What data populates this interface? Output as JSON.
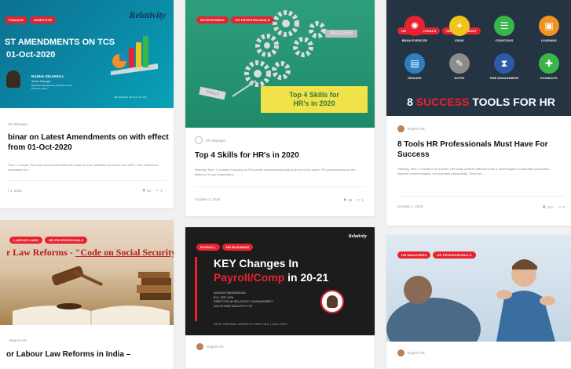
{
  "cards": {
    "c1": {
      "tags": [
        "FINANCE",
        "DIRECTIVE"
      ],
      "brand": "Relativity",
      "banner_line1": "ST AMENDMENTS ON TCS",
      "banner_line2": "01-Oct-2020",
      "presenter_name": "RADHA SELVARAJ",
      "presenter_role": "Senior Manager",
      "presenter_org": "Relativity Management Solutions India Private Limited",
      "footer_text": "BUSINESS MUST GO ON",
      "author": "HR Manager",
      "title": "binar on Latest Amendments on with effect from 01-Oct-2020",
      "excerpt": "Time: 1 minute There are several amendments made on Tax Collection at Source, Act 2020. This article is to summarize all ...",
      "date": "r 4, 2020",
      "views": "81",
      "comments": "0"
    },
    "c2": {
      "tags": [
        "RECRUITMENT",
        "HR PROFESSIONALS"
      ],
      "gear_text": "SUCCESS",
      "skills_text": "SKILLS",
      "banner": "Top 4 Skills for HR's in 2020",
      "author": "HR Manager",
      "title": "Top 4 Skills for HR's in 2020",
      "excerpt": "Reading Time: 2 minutes Focusing on HR-centric and technical skills to thrive in the world. HR professionals are the lifeblood of any organization ...",
      "date": "October 4, 2020",
      "views": "69",
      "comments": "1"
    },
    "c3": {
      "tags": [
        "HR PROFESSIONALS",
        "HR MANAGEMENT"
      ],
      "icons": [
        {
          "label": "BRAIN EXERCISE",
          "color": "#e8222e"
        },
        {
          "label": "IDEAS",
          "color": "#f2c31b"
        },
        {
          "label": "CONSCIOUS",
          "color": "#3ab54a"
        },
        {
          "label": "LEARNING",
          "color": "#f29221"
        },
        {
          "label": "READING",
          "color": "#2f7ec1"
        },
        {
          "label": "NOTES",
          "color": "#8c8c8c"
        },
        {
          "label": "TIME MANAGEMENT",
          "color": "#2a5aa8"
        },
        {
          "label": "ROUNDUPS",
          "color": "#3ab54a"
        }
      ],
      "banner_num": "8",
      "banner_success": "SUCCESS",
      "banner_rest": "TOOLS FOR HR",
      "author": "Rajesh HR",
      "title": "8 Tools HR Professionals Must Have For Success",
      "excerpt": "Reading Time: 1 minute In a nutshell, HR today outlines different tools & technologies to automate processes, improve communication, and increase productivity. There are ...",
      "date": "October 1, 2020",
      "views": "441",
      "comments": "0"
    },
    "c4": {
      "tags": [
        "LABOUR LAWS",
        "HR PROFESSIONALS"
      ],
      "headline_pre": "r Law Reforms - ",
      "headline_link": "\"Code on Social Security\"",
      "author": "Rajesh HR",
      "title": "or Labour Law Reforms in India –"
    },
    "c5": {
      "tags": [
        "PAYROLL",
        "HR BUSINESS"
      ],
      "brand": "Relativity",
      "line1": "KEY Changes In",
      "line2a": "Payroll/Comp",
      "line2b": " in 20-21",
      "presenter_name": "ADARSH MAHADEVAN",
      "presenter_quals": "B.E, CPP, CPA",
      "presenter_role": "DIRECTOR @ RELATIVITY MANAGEMENT",
      "presenter_org": "SOLUTIONS INDIA PVT LTD",
      "event": "NIPM CHENNAI MONTHLY MEETING | AUG 2020",
      "author": "Rajesh HR"
    },
    "c6": {
      "tags": [
        "HR MANAGERS",
        "HR PROFESSIONALS"
      ],
      "author": "Rajesh HR"
    }
  }
}
